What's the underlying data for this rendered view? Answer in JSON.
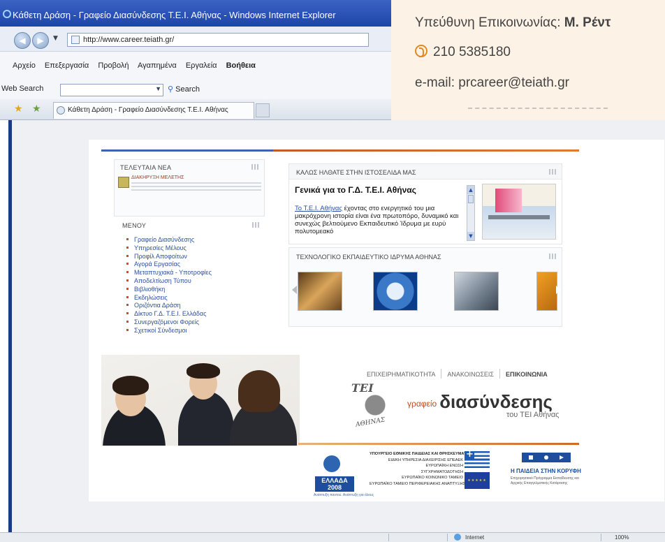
{
  "browser": {
    "title": "Κάθετη Δράση - Γραφείο Διασύνδεσης Τ.Ε.Ι. Αθήνας - Windows Internet Explorer",
    "url": "http://www.career.teiath.gr/",
    "menu": [
      "Αρχείο",
      "Επεξεργασία",
      "Προβολή",
      "Αγαπημένα",
      "Εργαλεία",
      "Βοήθεια"
    ],
    "search_label": "Web Search",
    "search_button": "Search",
    "tab_title": "Κάθετη Δράση - Γραφείο Διασύνδεσης Τ.Ε.Ι. Αθήνας",
    "status_zone": "Internet",
    "status_zoom": "100%"
  },
  "contact": {
    "line1_prefix": "Υπεύθυνη Επικοινωνίας: ",
    "line1_name": "Μ. Ρέντ",
    "phone": "210 5385180",
    "email": "e-mail: prcareer@teiath.gr"
  },
  "site": {
    "news_title": "ΤΕΛΕΥΤΑΙΑ ΝΕΑ",
    "news_item": "ΔΙΑΚΗΡΥΞΗ ΜΕΛΕΤΗΣ",
    "menu_title": "ΜΕΝΟΥ",
    "menu_items": [
      "Γραφείο Διασύνδεσης",
      "Υπηρεσίες Μέλους",
      "Προφίλ Αποφοίτων",
      "Αγορά Εργασίας",
      "Μεταπτυχιακά - Υποτροφίες",
      "Αποδελτίωση Τύπου",
      "Βιβλιοθήκη",
      "Εκδηλώσεις",
      "Οριζόντια Δράση",
      "Δίκτυο Γ.Δ. Τ.Ε.Ι. Ελλάδας",
      "Συνεργαζόμενοι Φορείς",
      "Σχετικοί Σύνδεσμοι"
    ],
    "welcome_title": "ΚΑΛΩΣ ΗΛΘΑΤΕ ΣΤΗΝ ΙΣΤΟΣΕΛΙΔΑ ΜΑΣ",
    "welcome_heading": "Γενικά για το Γ.Δ. Τ.Ε.Ι. Αθήνας",
    "welcome_link": "Το Τ.Ε.Ι. Αθήνας",
    "welcome_text": " έχοντας στο ενεργητικό του μια μακρόχρονη ιστορία είναι ένα πρωτοπόρο, δυναμικό και συνεχώς βελτιούμενο Εκπαιδευτικό Ίδρυμα με ευρύ πολυτομεακό",
    "tei_title": "ΤΕΧΝΟΛΟΓΙΚΟ ΕΚΠΑΙΔΕΥΤΙΚΟ ΙΔΡΥΜΑ ΑΘΗΝΑΣ",
    "nav_links": [
      "ΕΠΙΧΕΙΡΗΜΑΤΙΚΟΤΗΤΑ",
      "ΑΝΑΚΟΙΝΩΣΕΙΣ",
      "ΕΠΙΚΟΙΝΩΝΙΑ"
    ],
    "brand_small": "γραφείο",
    "brand_big": "διασύνδεσης",
    "brand_sub": "του ΤΕΙ Αθήνας",
    "seal_top": "ΤΕΙ",
    "seal_bottom": "ΑΘΗΝΑΣ",
    "greece_logo": "ΕΛΛΑΔΑ 2008",
    "greece_caption": "Ανάπτυξη παντού. Ανάπτυξη για όλους",
    "ministry_lines": [
      "ΥΠΟΥΡΓΕΙΟ ΕΘΝΙΚΗΣ ΠΑΙΔΕΙΑΣ ΚΑΙ ΘΡΗΣΚΕΥΜΑΤΩΝ",
      "ΕΙΔΙΚΗ ΥΠΗΡΕΣΙΑ ΔΙΑΧΕΙΡΙΣΗΣ ΕΠΕΑΕΚ",
      "ΕΥΡΩΠΑΪΚΗ ΕΝΩΣΗ",
      "ΣΥΓΧΡΗΜΑΤΟΔΟΤΗΣΗ",
      "ΕΥΡΩΠΑΪΚΟ ΚΟΙΝΩΝΙΚΟ ΤΑΜΕΙΟ",
      "ΕΥΡΩΠΑΪΚΟ ΤΑΜΕΙΟ ΠΕΡΙΦΕΡΕΙΑΚΗΣ ΑΝΑΠΤΥΞΗΣ"
    ],
    "eps_title": "Η ΠΑΙΔΕΙΑ ΣΤΗΝ ΚΟΡΥΦΗ",
    "eps_sub": "Επιχειρησιακό Πρόγραμμα Εκπαίδευσης και Αρχικής Επαγγελματικής Κατάρτισης"
  },
  "colors": {
    "ie_title": "#1d44a8",
    "accent_blue": "#3e62b0",
    "accent_orange": "#d06a28",
    "contact_bg": "#fdf2e6"
  }
}
